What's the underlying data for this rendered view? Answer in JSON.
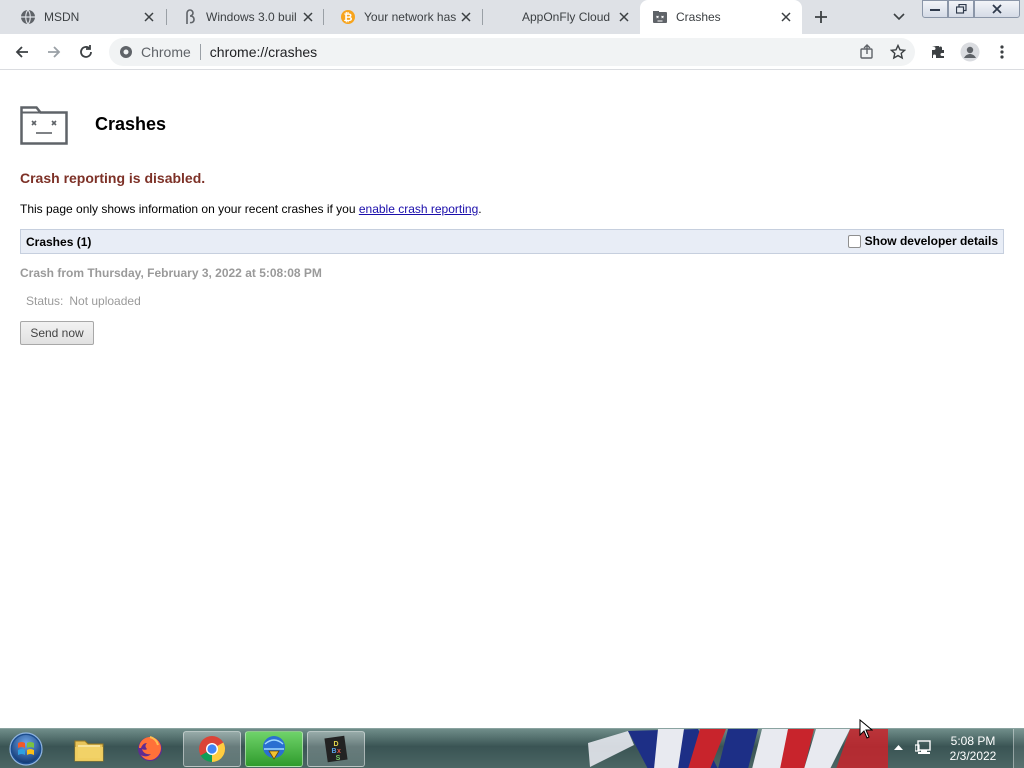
{
  "tabs": [
    {
      "label": "MSDN",
      "icon": "globe-icon"
    },
    {
      "label": "Windows 3.0 buil",
      "icon": "beta-icon"
    },
    {
      "label": "Your network has",
      "icon": "bitcoin-icon"
    },
    {
      "label": "AppOnFly Cloud",
      "icon": "blank-icon"
    },
    {
      "label": "Crashes",
      "icon": "crash-page-icon"
    }
  ],
  "omnibox": {
    "chip": "Chrome",
    "url": "chrome://crashes"
  },
  "page": {
    "title": "Crashes",
    "disabled_message": "Crash reporting is disabled.",
    "info_prefix": "This page only shows information on your recent crashes if you ",
    "info_link": "enable crash reporting",
    "info_suffix": ".",
    "crashes_header": "Crashes (1)",
    "dev_details_label": "Show developer details",
    "crash_title": "Crash from Thursday, February 3, 2022 at 5:08:08 PM",
    "status_label": "Status:",
    "status_value": "Not uploaded",
    "send_button": "Send now"
  },
  "taskbar": {
    "apps": [
      "explorer-icon",
      "firefox-icon",
      "chrome-icon",
      "internet-download-manager-icon",
      "dosbox-icon"
    ],
    "time": "5:08 PM",
    "date": "2/3/2022"
  },
  "colors": {
    "disabled_text": "#7d3127",
    "link": "#1a0dab",
    "crash_header_bg": "#e8edf6"
  }
}
